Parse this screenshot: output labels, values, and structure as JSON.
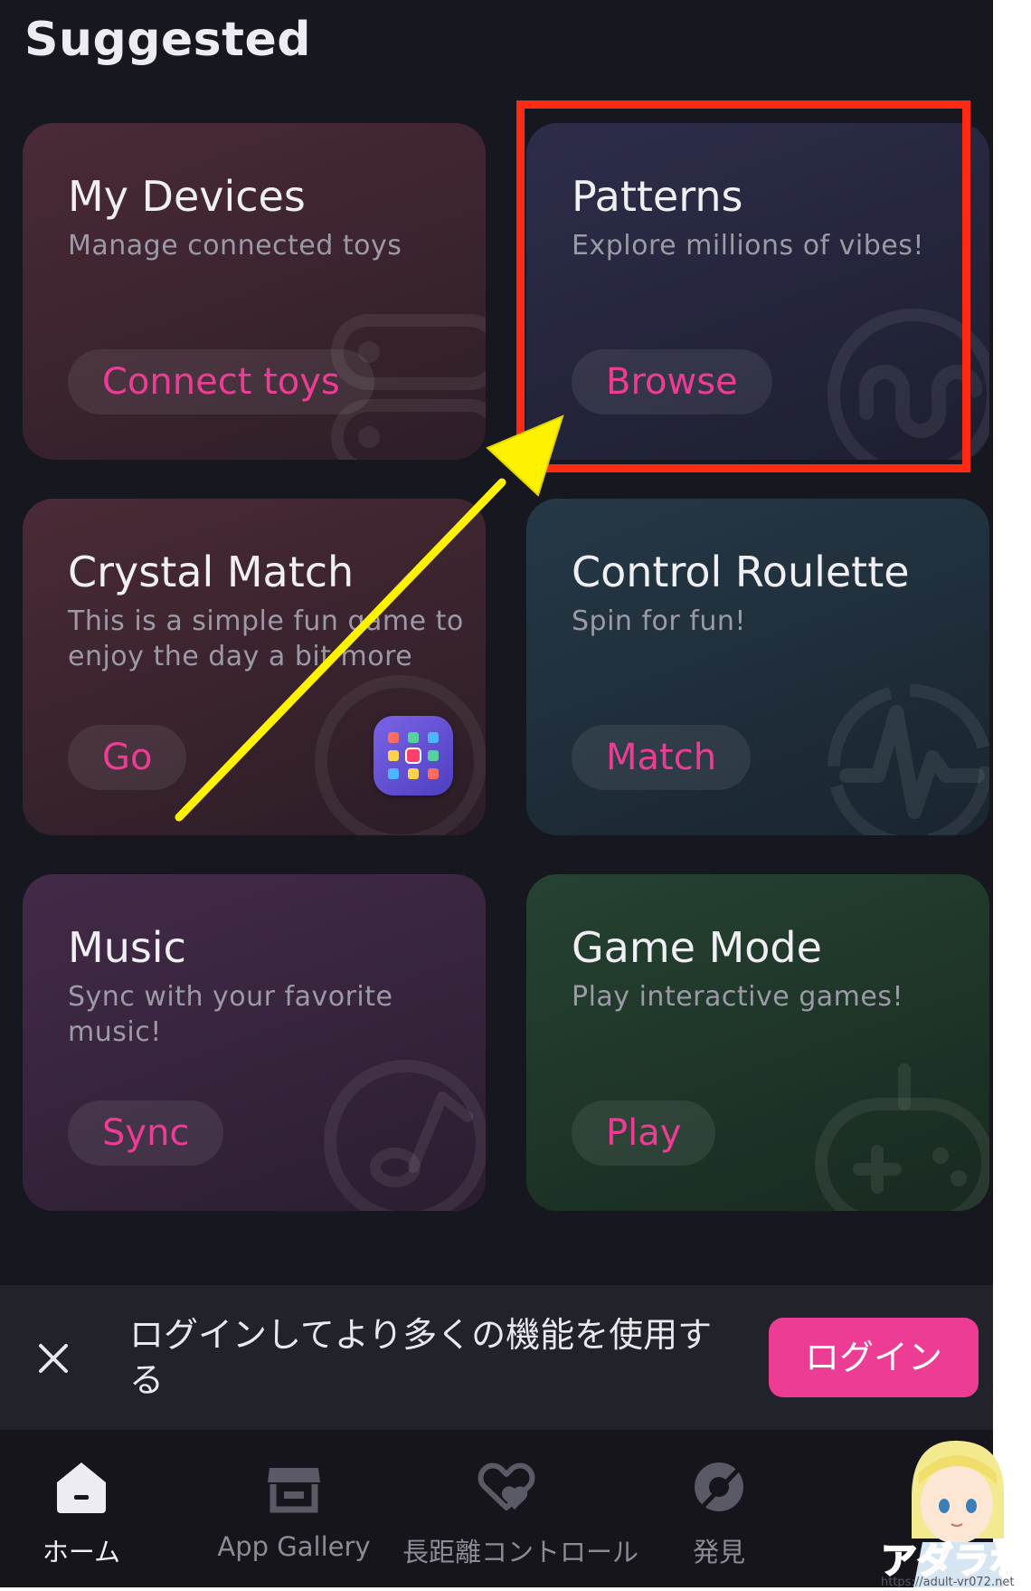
{
  "section": {
    "title": "Suggested"
  },
  "cards": [
    {
      "title": "My Devices",
      "subtitle": "Manage connected toys",
      "button": "Connect toys",
      "icon": "toy-outline-icon"
    },
    {
      "title": "Patterns",
      "subtitle": "Explore millions of vibes!",
      "button": "Browse",
      "icon": "wave-pattern-icon"
    },
    {
      "title": "Crystal Match",
      "subtitle": "This is a simple fun game to enjoy the day a bit more",
      "button": "Go",
      "icon": "crystal-match-app-icon"
    },
    {
      "title": "Control Roulette",
      "subtitle": "Spin for fun!",
      "button": "Match",
      "icon": "roulette-icon"
    },
    {
      "title": "Music",
      "subtitle": "Sync with your favorite music!",
      "button": "Sync",
      "icon": "music-note-icon"
    },
    {
      "title": "Game Mode",
      "subtitle": "Play interactive games!",
      "button": "Play",
      "icon": "gamepad-icon"
    }
  ],
  "login_bar": {
    "message": "ログインしてより多くの機能を使用する",
    "button": "ログイン"
  },
  "tabs": [
    {
      "label": "ホーム",
      "icon": "home-icon",
      "active": true
    },
    {
      "label": "App Gallery",
      "icon": "store-icon",
      "active": false
    },
    {
      "label": "長距離コントロール",
      "icon": "hearts-icon",
      "active": false
    },
    {
      "label": "発見",
      "icon": "discover-icon",
      "active": false
    }
  ],
  "watermark": {
    "text": "アダラボ",
    "url": "https://adult-vr072.net"
  },
  "colors": {
    "accent": "#ec3c94",
    "highlight_box": "#ff2a14",
    "arrow": "#fff200",
    "background": "#17171f"
  }
}
